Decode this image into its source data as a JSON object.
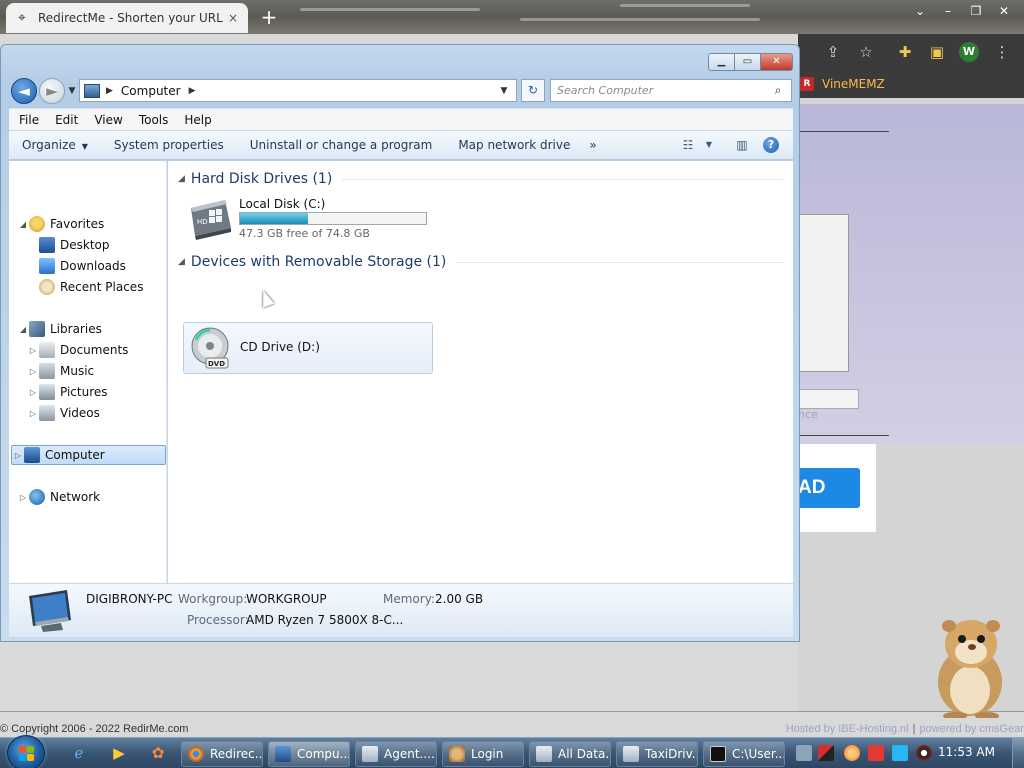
{
  "browser": {
    "tab_title": "RedirectMe - Shorten your URL r",
    "tab_close": "×",
    "new_tab": "+",
    "window_controls": [
      "⌄",
      "–",
      "❐",
      "✕"
    ],
    "toolbar_icons": [
      "share-icon",
      "star-icon",
      "extensions-icon",
      "sidebar-icon",
      "profile-avatar",
      "menu-icon"
    ],
    "profile_initial": "W",
    "bookmark": {
      "label": "VineMEMZ",
      "icon_letter": "R"
    },
    "upload_button_fragment": "AD",
    "faint_link_fragment": "nce",
    "footer_left": "© Copyright 2006 - 2022 RedirMe.com",
    "footer_right_1": "Hosted by IBE-Hosting.nl",
    "footer_right_sep": "|",
    "footer_right_2": "powered by cmsGear"
  },
  "explorer": {
    "window_controls": {
      "minimize": "▁",
      "maximize": "▭",
      "close": "✕"
    },
    "address": {
      "location": "Computer",
      "separator": "▶",
      "dropdown": "▼"
    },
    "nav": {
      "back": "◄",
      "forward": "►",
      "recent": "▼",
      "refresh": "↻"
    },
    "search": {
      "placeholder": "Search Computer",
      "icon": "⌕"
    },
    "menu": [
      "File",
      "Edit",
      "View",
      "Tools",
      "Help"
    ],
    "commands": [
      "Organize",
      "System properties",
      "Uninstall or change a program",
      "Map network drive"
    ],
    "commands_more": "»",
    "cmd_dropdown": "▼",
    "view_icon": "☷",
    "view_dropdown": "▼",
    "preview_icon": "▥",
    "help_icon": "?",
    "tree_expanded": "◢",
    "tree_collapsed": "▷",
    "nav_pane": {
      "favorites": {
        "label": "Favorites",
        "items": [
          "Desktop",
          "Downloads",
          "Recent Places"
        ]
      },
      "libraries": {
        "label": "Libraries",
        "items": [
          "Documents",
          "Music",
          "Pictures",
          "Videos"
        ]
      },
      "computer": "Computer",
      "network": "Network"
    },
    "groups": {
      "hdd": {
        "header": "Hard Disk Drives (1)",
        "drive": {
          "name": "Local Disk (C:)",
          "free_text": "47.3 GB free of 74.8 GB",
          "used_fraction": 0.368
        }
      },
      "removable": {
        "header": "Devices with Removable Storage (1)",
        "drive": {
          "name": "CD Drive (D:)"
        }
      }
    },
    "group_toggle": "◢",
    "details": {
      "computer_name": "DIGIBRONY-PC",
      "workgroup_label": "Workgroup:",
      "workgroup": "WORKGROUP",
      "memory_label": "Memory:",
      "memory": "2.00 GB",
      "processor_label": "Processor:",
      "processor": "AMD Ryzen 7 5800X 8-C..."
    }
  },
  "taskbar": {
    "tasks": [
      "Redirec...",
      "Compu...",
      "Agent....",
      "Login",
      "All Data...",
      "TaxiDriv...",
      "C:\\User..."
    ],
    "clock": "11:53 AM"
  },
  "colors": {
    "accent": "#1e88e5",
    "explorer_frame": "#b4cce6",
    "drive_bar": "#1d8fb2",
    "taskbar": "#3a5674"
  }
}
